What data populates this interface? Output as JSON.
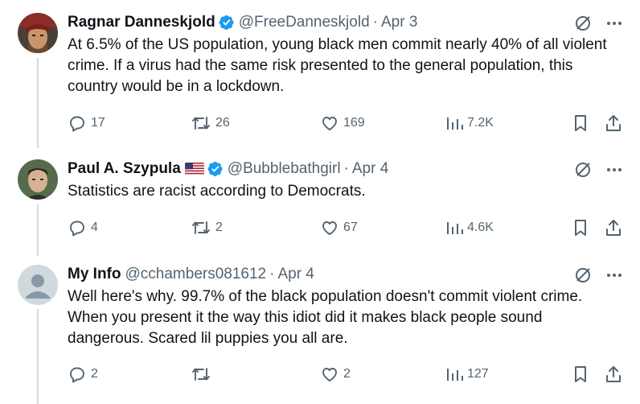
{
  "tweets": [
    {
      "name": "Ragnar Danneskjold",
      "handle": "@FreeDanneskjold",
      "separator": "·",
      "date": "Apr 3",
      "text": "At 6.5% of the US population, young black men commit nearly 40% of all violent crime. If a virus had the same risk presented to the general population, this country would be in a lockdown.",
      "replies": "17",
      "reposts": "26",
      "likes": "169",
      "views": "7.2K"
    },
    {
      "name": "Paul A. Szypula",
      "handle": "@Bubblebathgirl",
      "separator": "·",
      "date": "Apr 4",
      "text": "Statistics are racist according to Democrats.",
      "replies": "4",
      "reposts": "2",
      "likes": "67",
      "views": "4.6K"
    },
    {
      "name": "My Info",
      "handle": "@cchambers081612",
      "separator": "·",
      "date": "Apr 4",
      "text": "Well here's why. 99.7% of the black population doesn't commit violent crime. When you present it the way this idiot did it makes black people sound dangerous. Scared lil puppies you all are.",
      "replies": "2",
      "reposts": "",
      "likes": "2",
      "views": "127"
    }
  ],
  "colors": {
    "verified": "#1d9bf0",
    "muted": "#536471",
    "thread_line": "#cfd9de"
  }
}
